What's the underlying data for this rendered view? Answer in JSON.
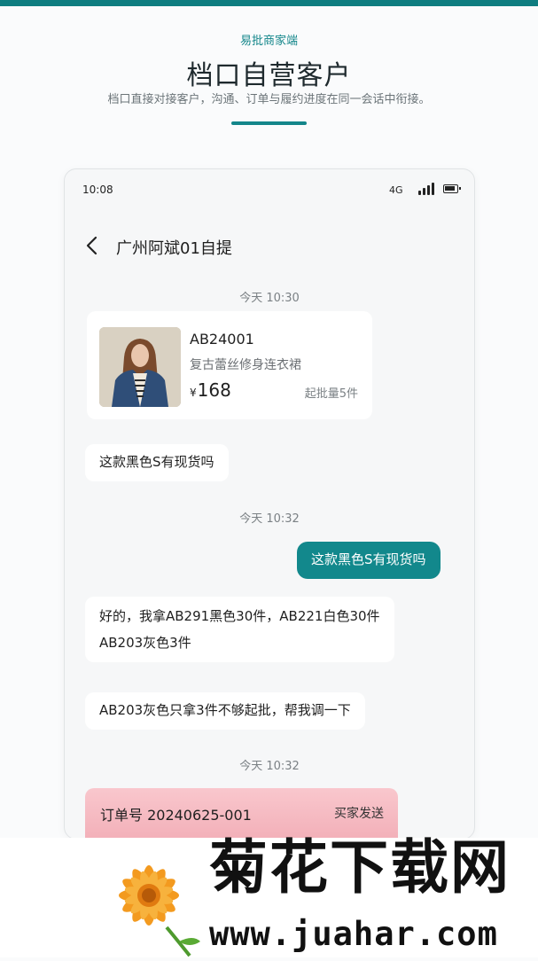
{
  "header": {
    "subtitle": "易批商家端",
    "title": "档口自营客户",
    "description": "档口直接对接客户，沟通、订单与履约进度在同一会话中衔接。"
  },
  "status_bar": {
    "time": "10:08",
    "network": "4G"
  },
  "chat": {
    "title": "广州阿斌01自提",
    "timestamps": [
      "今天 10:30",
      "今天 10:32",
      "今天 10:32"
    ],
    "product": {
      "code": "AB24001",
      "name": "复古蕾丝修身连衣裙",
      "currency": "¥",
      "price": "168",
      "moq": "起批量5件"
    },
    "messages": [
      {
        "side": "in",
        "lines": [
          "这款黑色S有现货吗"
        ]
      },
      {
        "side": "out",
        "lines": [
          "这款黑色S有现货吗"
        ]
      },
      {
        "side": "in",
        "lines": [
          "好的，我拿AB291黑色30件，AB221白色30件",
          "AB203灰色3件"
        ]
      },
      {
        "side": "in",
        "lines": [
          "AB203灰色只拿3件不够起批，帮我调一下"
        ]
      }
    ],
    "order": {
      "number": "订单号 20240625-001",
      "tag": "买家发送"
    }
  },
  "watermark": {
    "title": "菊花下载网",
    "url": "www.juahar.com"
  },
  "colors": {
    "accent": "#13868a",
    "top_bar": "#0f7d80",
    "order_card": "#f2aeb7"
  }
}
